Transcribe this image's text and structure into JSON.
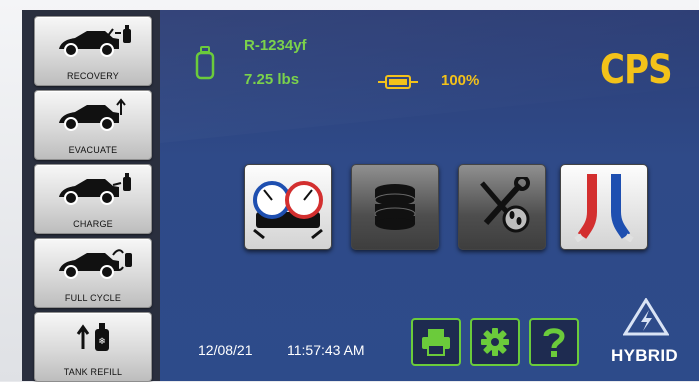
{
  "sidebar": {
    "items": [
      {
        "label": "RECOVERY"
      },
      {
        "label": "EVACUATE"
      },
      {
        "label": "CHARGE"
      },
      {
        "label": "FULL CYCLE"
      },
      {
        "label": "TANK REFILL"
      }
    ]
  },
  "status": {
    "refrigerant": "R-1234yf",
    "weight": "7.25 lbs",
    "battery_percent": "100%"
  },
  "brand": {
    "logo": "CPS"
  },
  "footer": {
    "date": "12/08/21",
    "time": "11:57:43 AM",
    "hybrid_label": "HYBRID"
  },
  "icons": {
    "tank": "tank-icon",
    "battery": "battery-icon",
    "manifold": "manifold-gauges-icon",
    "database": "database-icon",
    "service": "tools-service-icon",
    "hoses": "hoses-icon",
    "print": "printer-icon",
    "settings": "gear-icon",
    "help": "help-icon",
    "hybrid": "hybrid-warning-icon"
  },
  "colors": {
    "accent_green": "#6bcb3b",
    "brand_yellow": "#f3c21a",
    "screen_blue": "#2f4a88"
  }
}
